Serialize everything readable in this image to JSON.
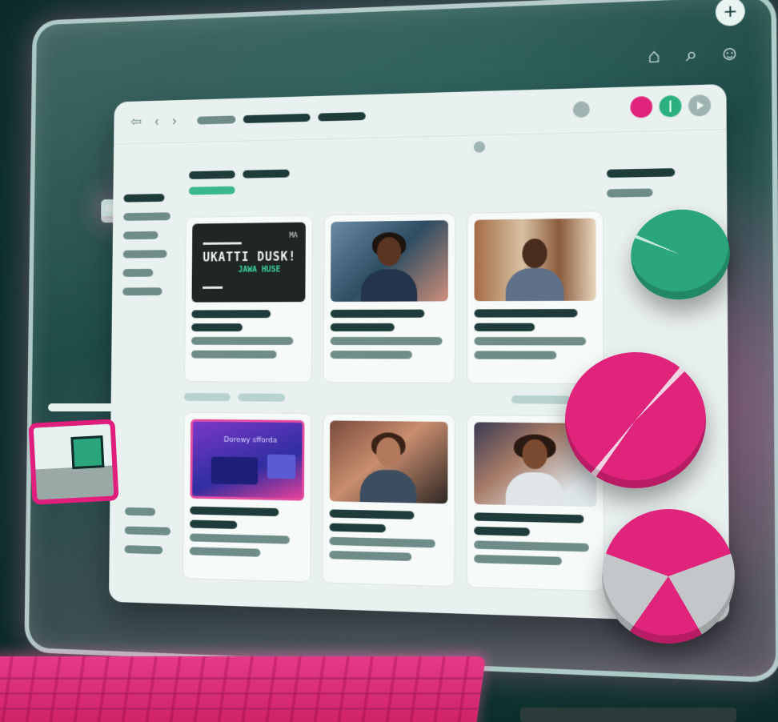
{
  "app": {
    "featured_card": {
      "title": "UKATTI DUSK!",
      "subtitle": "JAWA HUSE",
      "tag": "MA"
    },
    "purple_card": {
      "title": "Dorewy sfforda"
    }
  },
  "icons": {
    "plus": "+",
    "top_right": [
      "home-icon",
      "search-icon",
      "user-icon"
    ],
    "nav": "⇦ ‹ ›"
  },
  "colors": {
    "accent_pink": "#e0237b",
    "accent_green": "#2aa57c",
    "panel_bg": "#e9f1f0",
    "dark_text": "#1f3c3a"
  }
}
